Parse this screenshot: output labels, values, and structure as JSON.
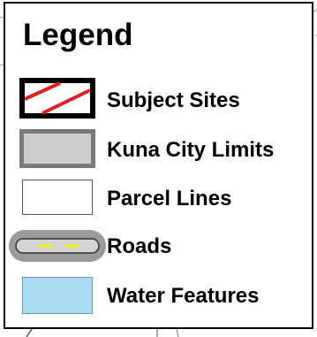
{
  "legend": {
    "title": "Legend",
    "items": [
      {
        "label": "Subject Sites",
        "symbol": "subject-sites-symbol",
        "border_color": "#000000",
        "stripe_color": "#e02020",
        "fill_color": "#ffffff"
      },
      {
        "label": "Kuna City Limits",
        "symbol": "city-limits-symbol",
        "border_color": "#7a7a7a",
        "fill_color": "#cccccc"
      },
      {
        "label": "Parcel Lines",
        "symbol": "parcel-lines-symbol",
        "border_color": "#555555",
        "fill_color": "#ffffff"
      },
      {
        "label": "Roads",
        "symbol": "road-symbol",
        "casing_color": "#9a9a9a",
        "fill_color": "#d4d4d4",
        "centerline_color": "#f5f000"
      },
      {
        "label": "Water Features",
        "symbol": "water-features-symbol",
        "border_color": "#6a9bb0",
        "fill_color": "#a9dcf2"
      }
    ]
  }
}
